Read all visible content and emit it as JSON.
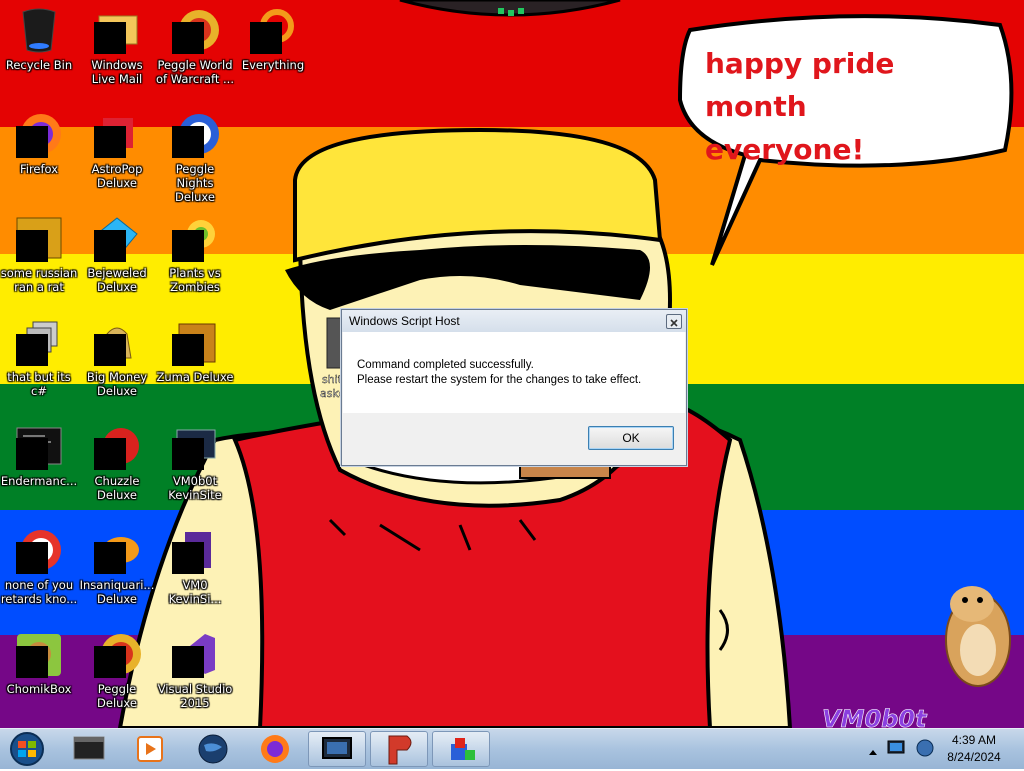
{
  "colors": {
    "stripes": [
      "#e40303",
      "#ff8c00",
      "#ffed00",
      "#008026",
      "#004dff",
      "#750787"
    ],
    "bubble_text": "#e0161c",
    "taskbar": "#a9c3df"
  },
  "desktop": {
    "speech_bubble": {
      "line1": "happy pride month",
      "line2": "everyone!"
    },
    "watermark": "VM0b0t",
    "icons": [
      {
        "label": "Recycle Bin",
        "icon": "recycle-bin-icon"
      },
      {
        "label": "Windows Live Mail",
        "icon": "mail-icon"
      },
      {
        "label": "Peggle World of Warcraft ...",
        "icon": "peggle-icon"
      },
      {
        "label": "Everything",
        "icon": "search-icon"
      },
      {
        "label": "Firefox",
        "icon": "firefox-icon"
      },
      {
        "label": "AstroPop Deluxe",
        "icon": "game-icon"
      },
      {
        "label": "Peggle Nights Deluxe",
        "icon": "peggle-icon"
      },
      {
        "label": "some russian ran a rat",
        "icon": "game-icon"
      },
      {
        "label": "Bejeweled Deluxe",
        "icon": "gem-icon"
      },
      {
        "label": "Plants vs Zombies",
        "icon": "plant-icon"
      },
      {
        "label": "that but its c#",
        "icon": "window-icon"
      },
      {
        "label": "Big Money Deluxe",
        "icon": "money-icon"
      },
      {
        "label": "Zuma Deluxe",
        "icon": "zuma-icon"
      },
      {
        "label": "Endermanc...",
        "icon": "terminal-icon"
      },
      {
        "label": "Chuzzle Deluxe",
        "icon": "chuzzle-icon"
      },
      {
        "label": "VM0b0t KevinSite",
        "icon": "monitor-icon"
      },
      {
        "label": "none of you retards kno...",
        "icon": "browser-icon"
      },
      {
        "label": "Insaniquari... Deluxe",
        "icon": "fish-icon"
      },
      {
        "label": "VM0 KevinSi...",
        "icon": "app-icon"
      },
      {
        "label": "ChomikBox",
        "icon": "hamster-icon"
      },
      {
        "label": "Peggle Deluxe",
        "icon": "peggle-icon"
      },
      {
        "label": "Visual Studio 2015",
        "icon": "visual-studio-icon"
      }
    ],
    "partial_icon_label": "shit\naske"
  },
  "dialog": {
    "title": "Windows Script Host",
    "line1": "Command completed successfully.",
    "line2": "Please restart the system for the changes to take effect.",
    "ok_label": "OK"
  },
  "taskbar": {
    "start": "start-orb-icon",
    "items": [
      {
        "icon": "cmd-icon"
      },
      {
        "icon": "media-player-icon"
      },
      {
        "icon": "globe-icon"
      },
      {
        "icon": "firefox-icon"
      },
      {
        "icon": "monitor-icon"
      },
      {
        "icon": "paint-icon"
      },
      {
        "icon": "cube-icon"
      }
    ],
    "clock_time": "4:39 AM",
    "clock_date": "8/24/2024"
  }
}
